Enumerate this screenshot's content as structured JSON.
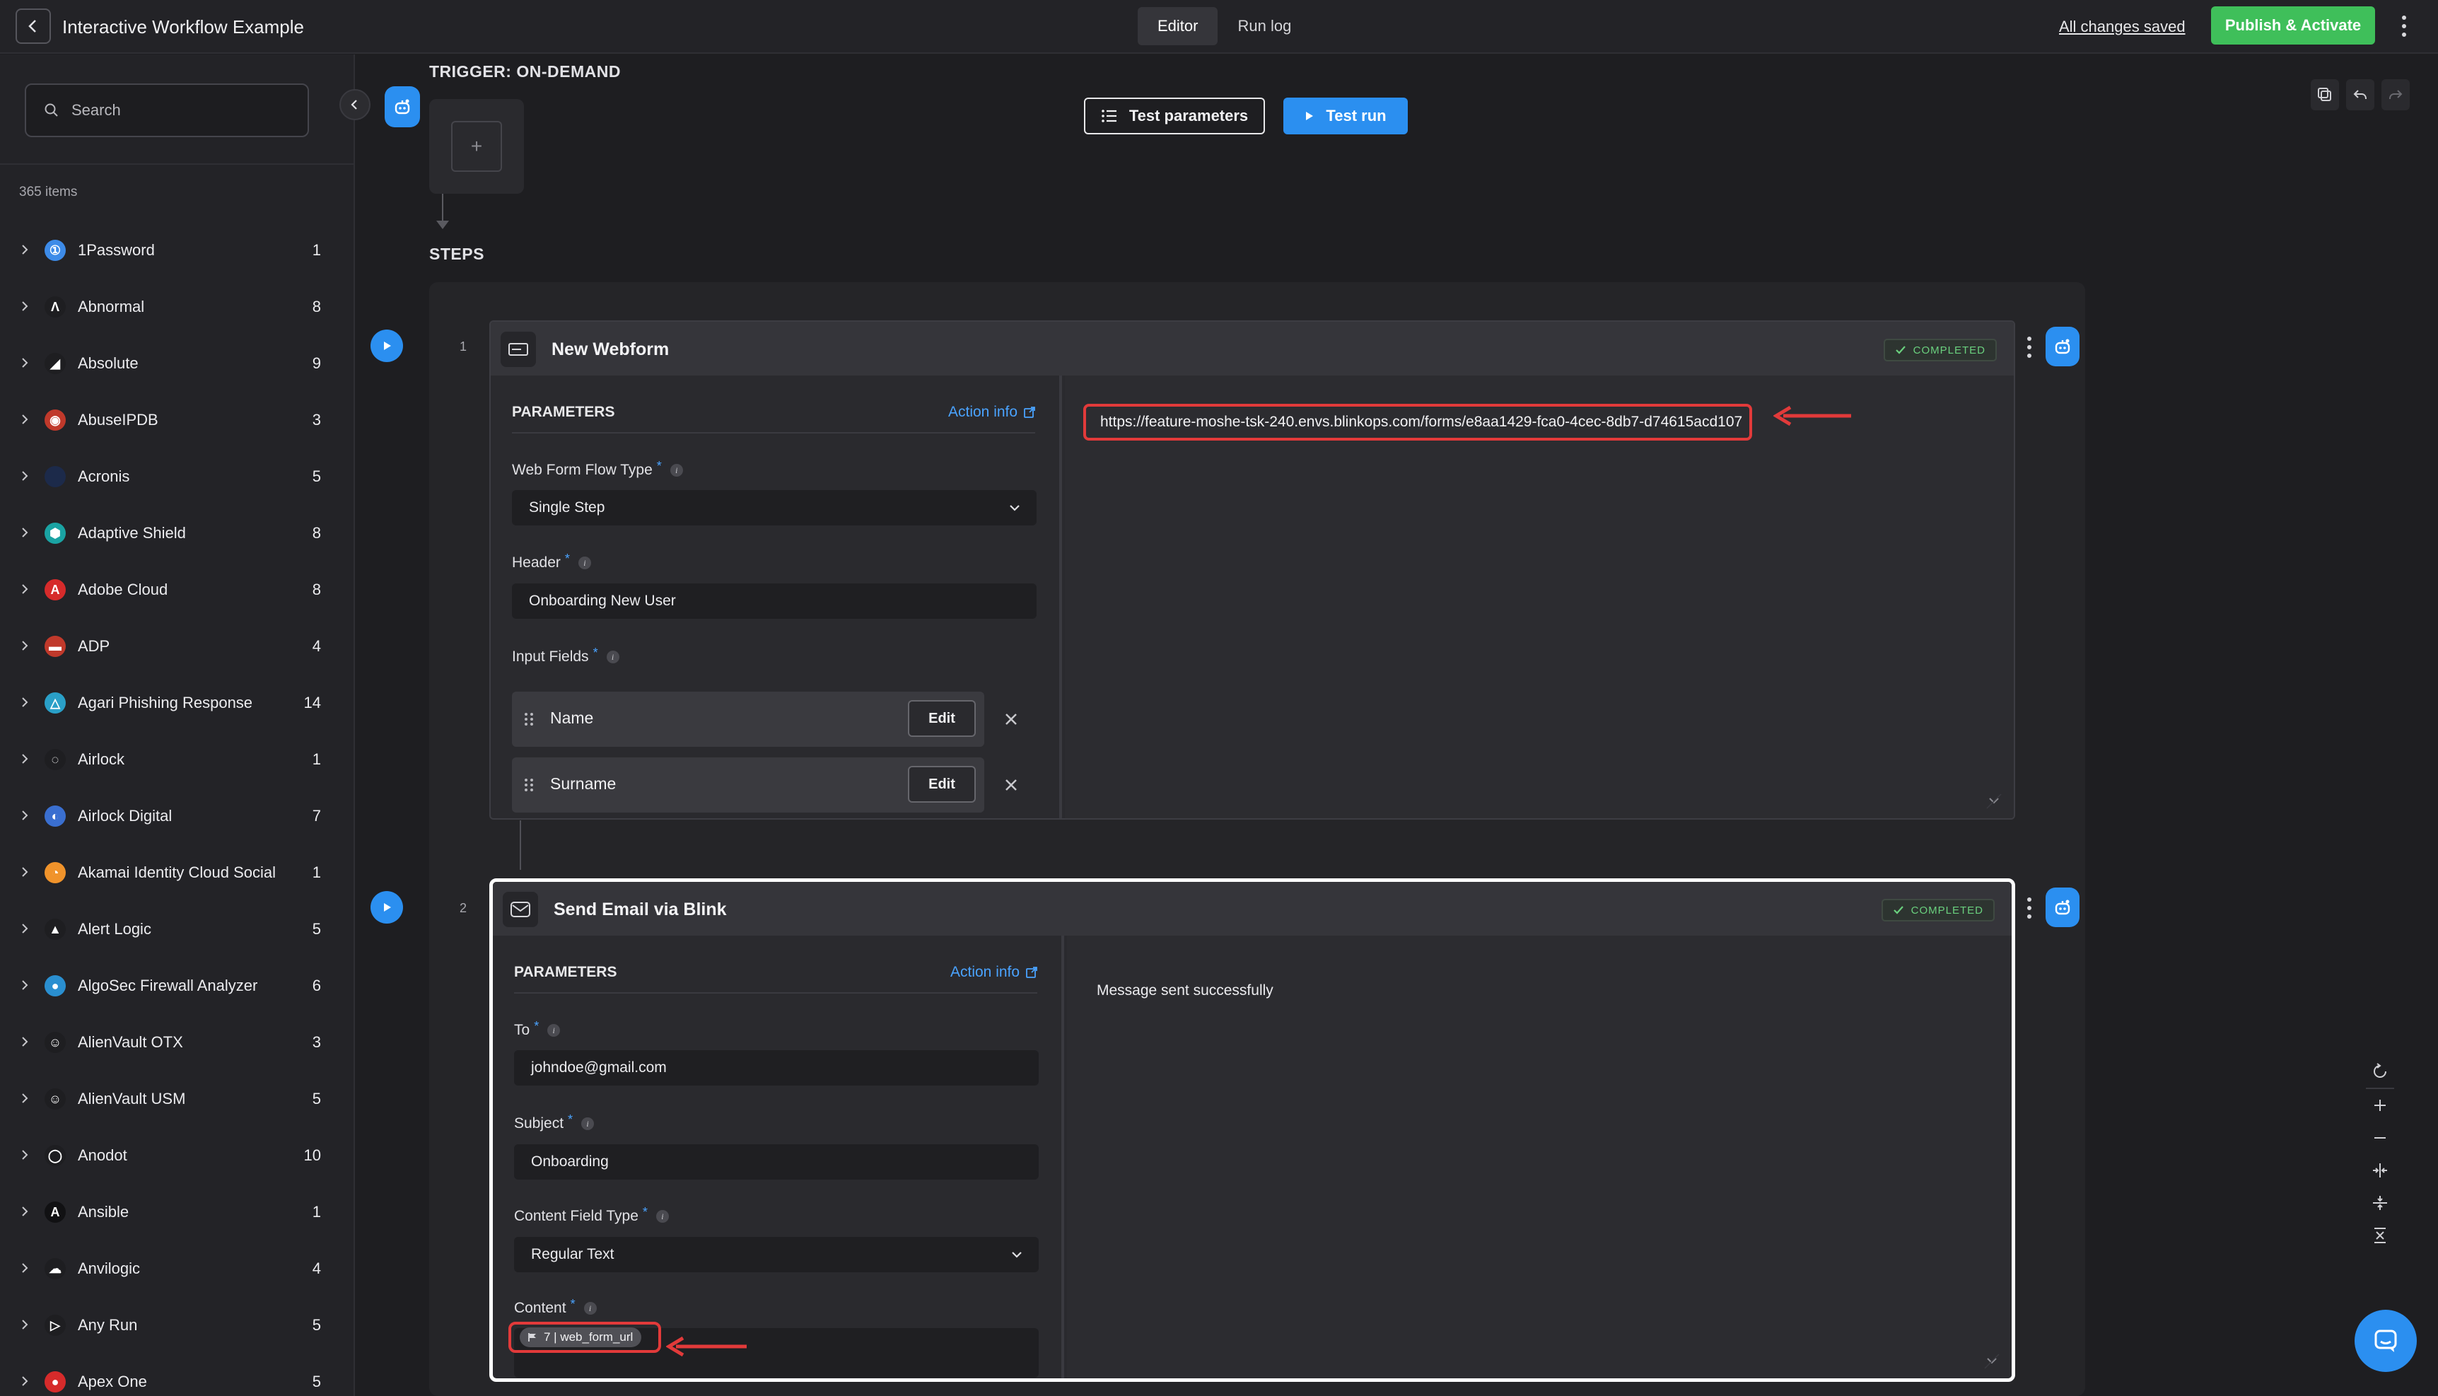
{
  "header": {
    "title": "Interactive Workflow Example",
    "tabs": [
      {
        "label": "Editor",
        "active": true
      },
      {
        "label": "Run log",
        "active": false
      }
    ],
    "saved_status": "All changes saved",
    "publish_label": "Publish & Activate"
  },
  "sidebar": {
    "search_placeholder": "Search",
    "items_count": "365 items",
    "items": [
      {
        "name": "1Password",
        "count": "1",
        "logo_color": "#3d8be8",
        "logo_glyph": "①"
      },
      {
        "name": "Abnormal",
        "count": "8",
        "logo_color": "#1e1e21",
        "logo_glyph": "Λ"
      },
      {
        "name": "Absolute",
        "count": "9",
        "logo_color": "#1e1e21",
        "logo_glyph": "◢"
      },
      {
        "name": "AbuseIPDB",
        "count": "3",
        "logo_color": "#c0392b",
        "logo_glyph": "◉"
      },
      {
        "name": "Acronis",
        "count": "5",
        "logo_color": "#1c2a4a",
        "logo_glyph": ""
      },
      {
        "name": "Adaptive Shield",
        "count": "8",
        "logo_color": "#1aa3a3",
        "logo_glyph": "⬢"
      },
      {
        "name": "Adobe Cloud",
        "count": "8",
        "logo_color": "#d62b2b",
        "logo_glyph": "A"
      },
      {
        "name": "ADP",
        "count": "4",
        "logo_color": "#c0392b",
        "logo_glyph": "▬"
      },
      {
        "name": "Agari Phishing Response",
        "count": "14",
        "logo_color": "#2aa0c8",
        "logo_glyph": "△"
      },
      {
        "name": "Airlock",
        "count": "1",
        "logo_color": "#1e1e21",
        "logo_glyph": "◌"
      },
      {
        "name": "Airlock Digital",
        "count": "7",
        "logo_color": "#3a6fd0",
        "logo_glyph": "◐"
      },
      {
        "name": "Akamai Identity Cloud Social",
        "count": "1",
        "logo_color": "#f0932b",
        "logo_glyph": "◔"
      },
      {
        "name": "Alert Logic",
        "count": "5",
        "logo_color": "#1e1e21",
        "logo_glyph": "▲"
      },
      {
        "name": "AlgoSec Firewall Analyzer",
        "count": "6",
        "logo_color": "#2a8fd0",
        "logo_glyph": "●"
      },
      {
        "name": "AlienVault OTX",
        "count": "3",
        "logo_color": "#1e1e21",
        "logo_glyph": "☺"
      },
      {
        "name": "AlienVault USM",
        "count": "5",
        "logo_color": "#1e1e21",
        "logo_glyph": "☺"
      },
      {
        "name": "Anodot",
        "count": "10",
        "logo_color": "#1e1e21",
        "logo_glyph": "◯"
      },
      {
        "name": "Ansible",
        "count": "1",
        "logo_color": "#111113",
        "logo_glyph": "A"
      },
      {
        "name": "Anvilogic",
        "count": "4",
        "logo_color": "#1e1e21",
        "logo_glyph": "☁"
      },
      {
        "name": "Any Run",
        "count": "5",
        "logo_color": "#1e1e21",
        "logo_glyph": "▷"
      },
      {
        "name": "Apex One",
        "count": "5",
        "logo_color": "#d62b2b",
        "logo_glyph": "●"
      }
    ]
  },
  "canvas": {
    "trigger_label": "TRIGGER: ON-DEMAND",
    "test_parameters_label": "Test parameters",
    "test_run_label": "Test run",
    "steps_label": "STEPS"
  },
  "steps": [
    {
      "number": "1",
      "title": "New Webform",
      "status": "COMPLETED",
      "params_title": "PARAMETERS",
      "action_info": "Action info",
      "fields": {
        "flow_type_label": "Web Form Flow Type",
        "flow_type_value": "Single Step",
        "header_label": "Header",
        "header_value": "Onboarding New User",
        "input_fields_label": "Input Fields",
        "input_rows": [
          {
            "name": "Name",
            "edit_label": "Edit"
          },
          {
            "name": "Surname",
            "edit_label": "Edit"
          }
        ]
      },
      "output": "https://feature-moshe-tsk-240.envs.blinkops.com/forms/e8aa1429-fca0-4cec-8db7-d74615acd107"
    },
    {
      "number": "2",
      "title": "Send Email via Blink",
      "status": "COMPLETED",
      "params_title": "PARAMETERS",
      "action_info": "Action info",
      "fields": {
        "to_label": "To",
        "to_value": "johndoe@gmail.com",
        "subject_label": "Subject",
        "subject_value": "Onboarding",
        "content_type_label": "Content Field Type",
        "content_type_value": "Regular Text",
        "content_label": "Content",
        "content_chip": "7 | web_form_url"
      },
      "output": "Message sent successfully"
    }
  ],
  "colors": {
    "accent": "#2b8ff0",
    "publish": "#3fbf5a",
    "annotation": "#e23a3a",
    "completed": "#6ad07e"
  }
}
